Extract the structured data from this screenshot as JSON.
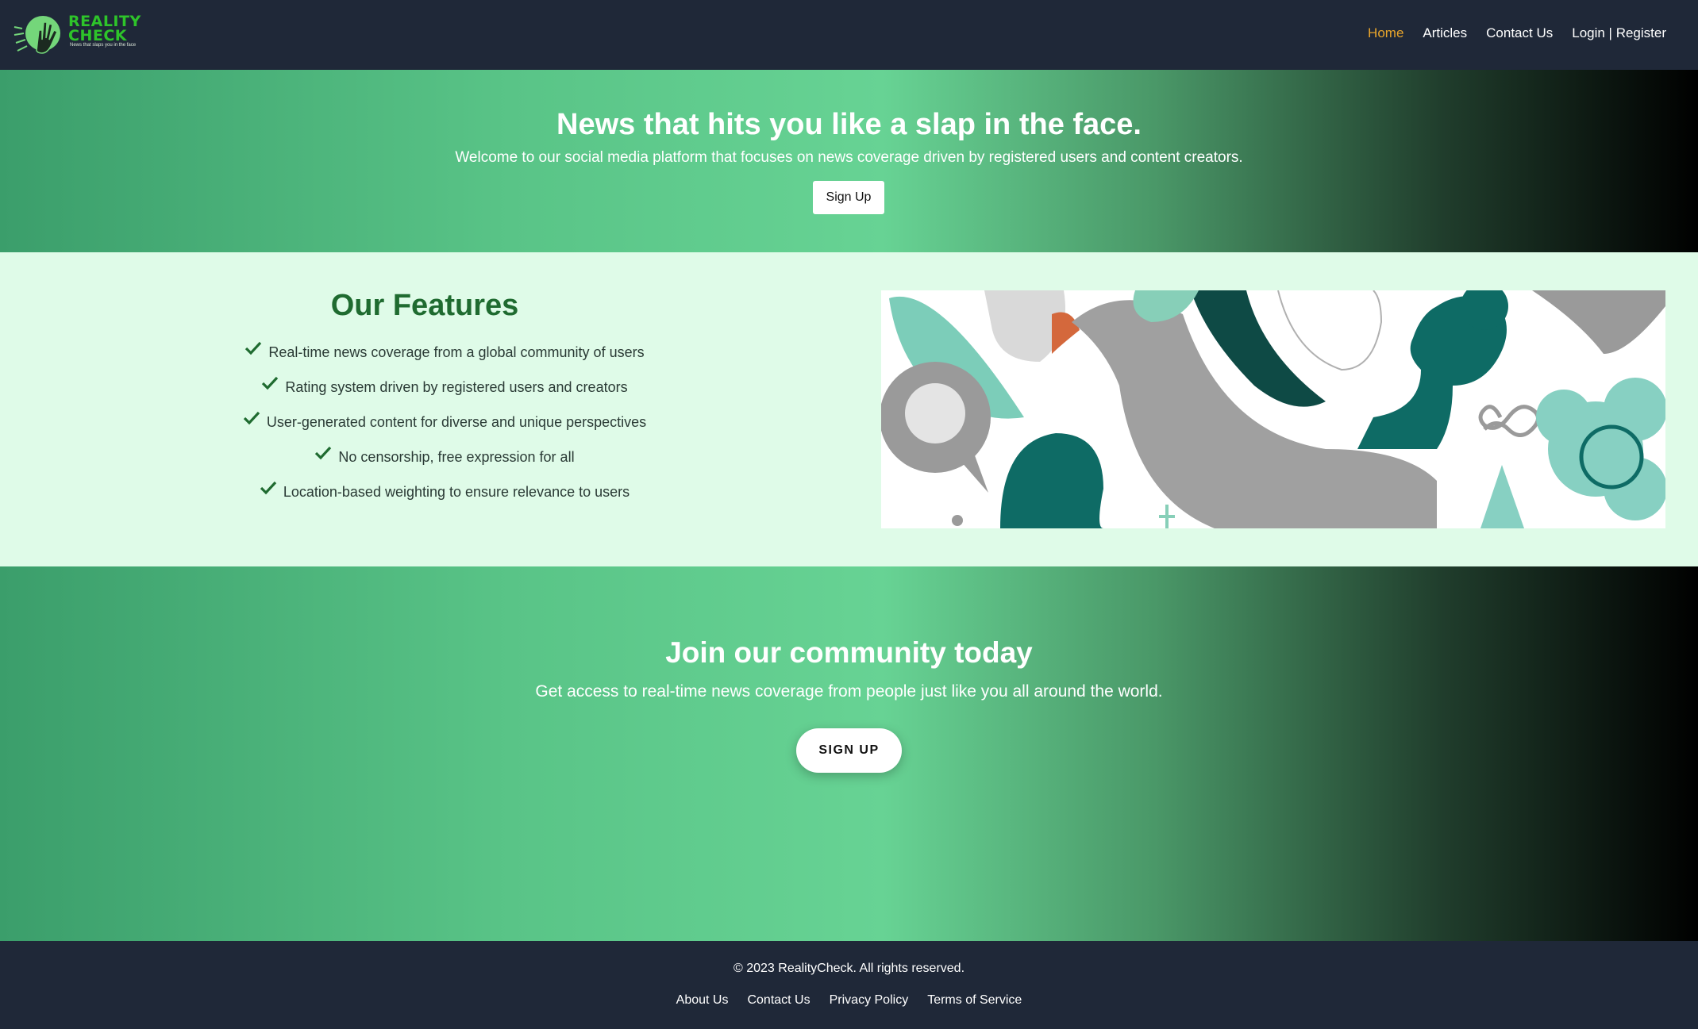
{
  "brand": {
    "name_line1": "REALITY",
    "name_line2": "CHECK",
    "tagline": "News that slaps you in the face",
    "primary_color": "#2ec42a",
    "nav_bg": "#1f2838"
  },
  "nav": {
    "items": [
      {
        "label": "Home",
        "active": true
      },
      {
        "label": "Articles",
        "active": false
      },
      {
        "label": "Contact Us",
        "active": false
      },
      {
        "label": "Login | Register",
        "active": false
      }
    ],
    "active_color": "#e8a52b"
  },
  "hero": {
    "title": "News that hits you like a slap in the face.",
    "subtitle": "Welcome to our social media platform that focuses on news coverage driven by registered users and content creators.",
    "cta_label": "Sign Up"
  },
  "features": {
    "title": "Our Features",
    "items": [
      "Real-time news coverage from a global community of users",
      "Rating system driven by registered users and creators",
      "User-generated content for diverse and unique perspectives",
      "No censorship, free expression for all",
      "Location-based weighting to ensure relevance to users"
    ],
    "check_color": "#1f6b30",
    "bg_color": "#dffbe8"
  },
  "community": {
    "title": "Join our community today",
    "subtitle": "Get access to real-time news coverage from people just like you all around the world.",
    "cta_label": "SIGN UP"
  },
  "footer": {
    "copyright": "© 2023 RealityCheck. All rights reserved.",
    "links": [
      "About Us",
      "Contact Us",
      "Privacy Policy",
      "Terms of Service"
    ]
  }
}
